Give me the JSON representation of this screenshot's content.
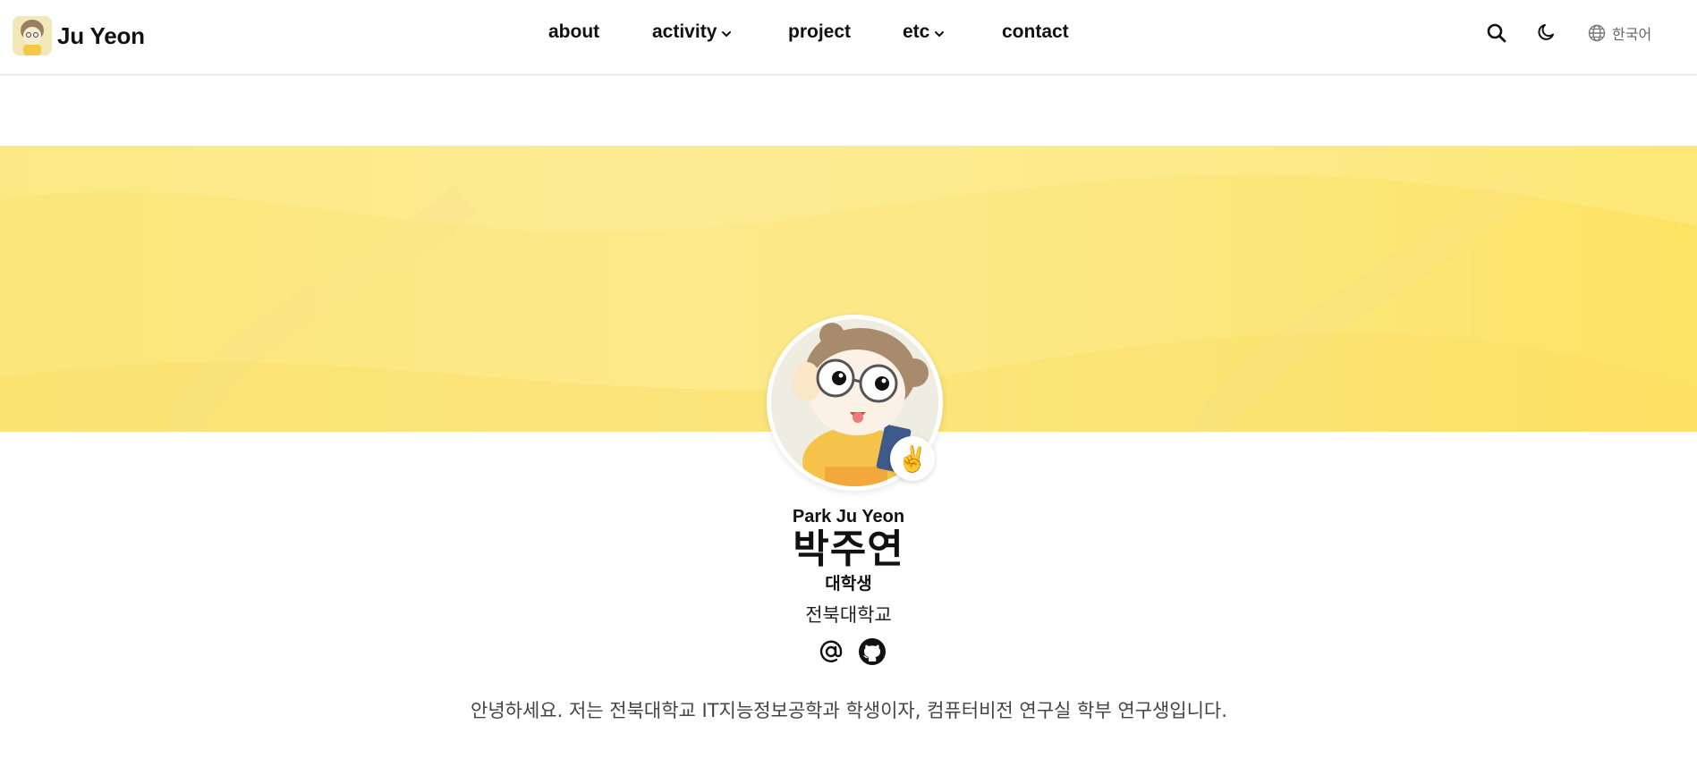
{
  "header": {
    "brand_name": "Ju Yeon",
    "nav": [
      {
        "label": "about",
        "has_dropdown": false
      },
      {
        "label": "activity",
        "has_dropdown": true
      },
      {
        "label": "project",
        "has_dropdown": false
      },
      {
        "label": "etc",
        "has_dropdown": true
      },
      {
        "label": "contact",
        "has_dropdown": false
      }
    ],
    "tools": {
      "search_icon": "search-icon",
      "theme_icon": "moon-icon",
      "language_icon": "globe-icon",
      "language_label": "한국어"
    }
  },
  "banner": {
    "color": "#fce77f"
  },
  "profile": {
    "name_en": "Park Ju Yeon",
    "name_ko": "박주연",
    "role": "대학생",
    "organization": "전북대학교",
    "status_emoji": "✌️",
    "socials": [
      {
        "icon": "at-sign-icon"
      },
      {
        "icon": "github-icon"
      }
    ]
  },
  "bio": {
    "text": "안녕하세요. 저는 전북대학교 IT지능정보공학과 학생이자, 컴퓨터비전 연구실 학부 연구생입니다."
  }
}
